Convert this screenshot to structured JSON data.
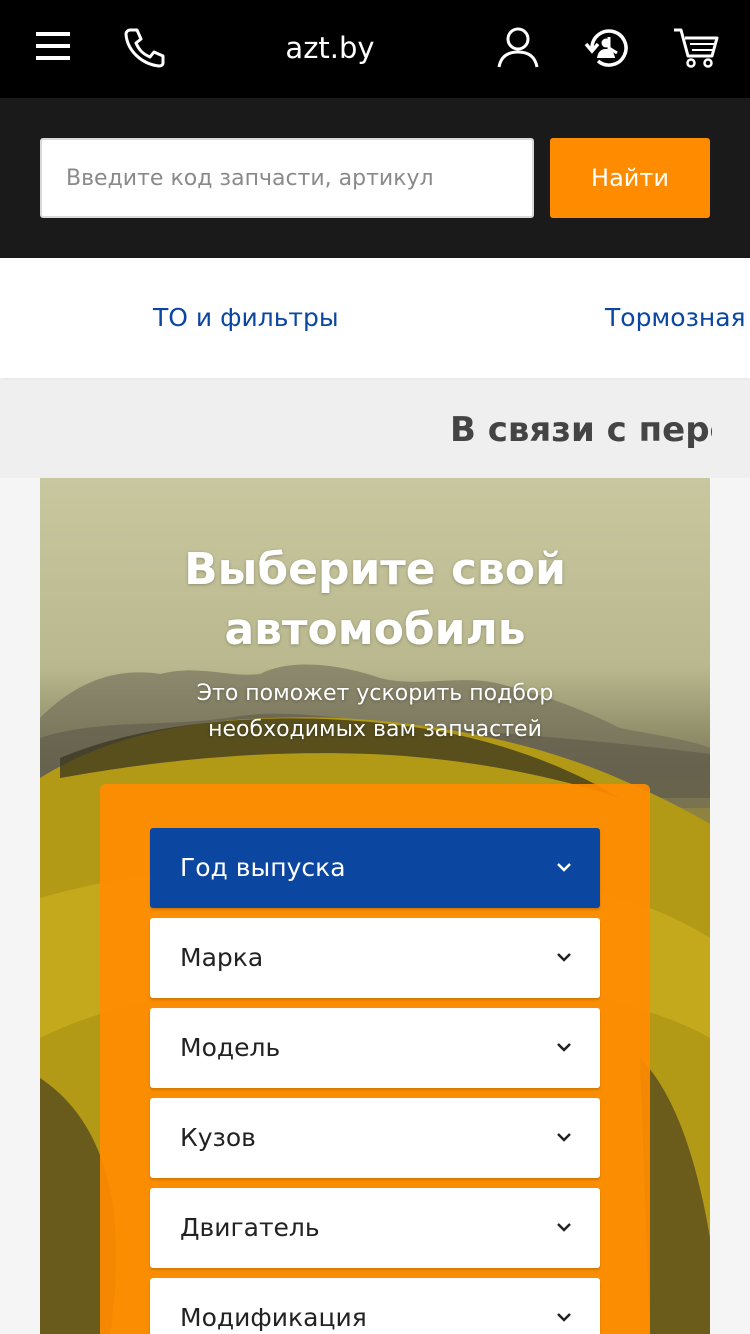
{
  "header": {
    "site_title": "azt.by",
    "icons": [
      "menu-icon",
      "phone-icon",
      "user-icon",
      "history-icon",
      "cart-icon"
    ]
  },
  "search": {
    "placeholder": "Введите код запчасти, артикул",
    "button_label": "Найти"
  },
  "categories": {
    "items": [
      {
        "label": "ТО и фильтры"
      },
      {
        "label": "Тормозная"
      }
    ]
  },
  "announcement": {
    "text": "В связи с пере"
  },
  "hero": {
    "title_line1": "Выберите свой",
    "title_line2": "автомобиль",
    "subtitle_line1": "Это поможет ускорить подбор",
    "subtitle_line2": "необходимых вам запчастей"
  },
  "selectors": [
    {
      "label": "Год выпуска",
      "active": true
    },
    {
      "label": "Марка",
      "active": false
    },
    {
      "label": "Модель",
      "active": false
    },
    {
      "label": "Кузов",
      "active": false
    },
    {
      "label": "Двигатель",
      "active": false
    },
    {
      "label": "Модификация",
      "active": false
    }
  ],
  "colors": {
    "accent": "#ff8c00",
    "brand_blue": "#0b47a1",
    "header_bg": "#000000"
  }
}
